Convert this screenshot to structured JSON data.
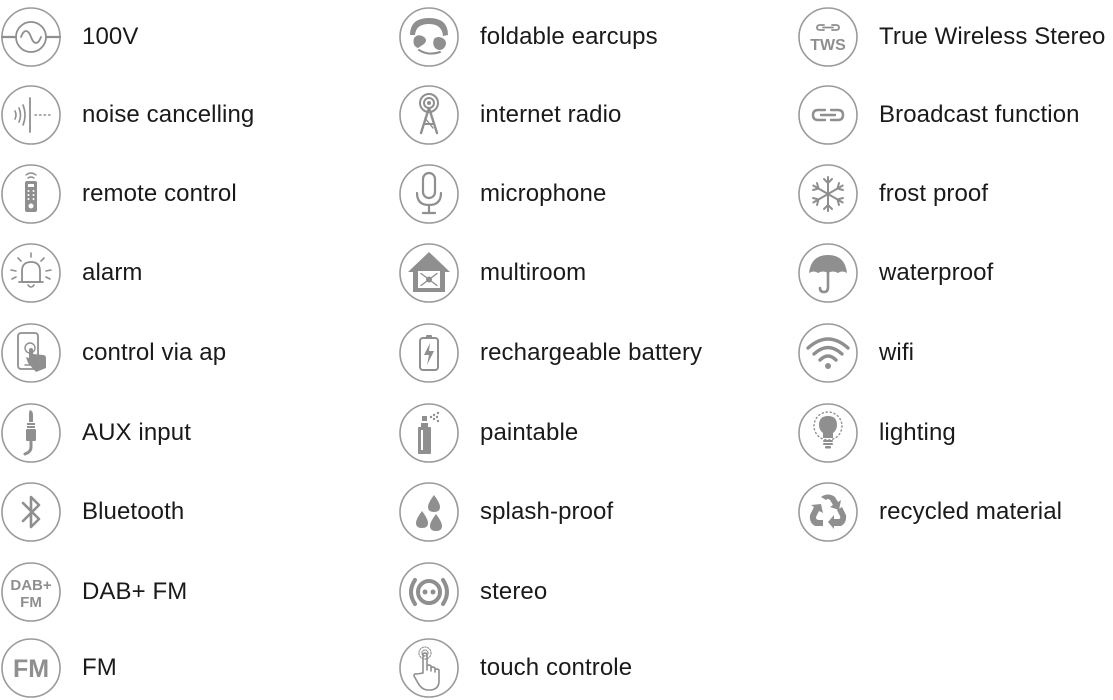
{
  "columns": [
    {
      "items": [
        {
          "label": "100V",
          "icon": "ac-voltage-icon"
        },
        {
          "label": "noise cancelling",
          "icon": "noise-cancelling-icon"
        },
        {
          "label": "remote control",
          "icon": "remote-control-icon"
        },
        {
          "label": "alarm",
          "icon": "alarm-icon"
        },
        {
          "label": "control via ap",
          "icon": "phone-touch-icon"
        },
        {
          "label": "AUX input",
          "icon": "aux-jack-icon"
        },
        {
          "label": "Bluetooth",
          "icon": "bluetooth-icon"
        },
        {
          "label": "DAB+ FM",
          "icon": "dab-fm-icon"
        },
        {
          "label": "FM",
          "icon": "fm-icon"
        }
      ]
    },
    {
      "items": [
        {
          "label": "foldable earcups",
          "icon": "headphones-icon"
        },
        {
          "label": "internet radio",
          "icon": "radio-tower-icon"
        },
        {
          "label": "microphone",
          "icon": "microphone-icon"
        },
        {
          "label": "multiroom",
          "icon": "multiroom-house-icon"
        },
        {
          "label": "rechargeable battery",
          "icon": "battery-icon"
        },
        {
          "label": "paintable",
          "icon": "spray-can-icon"
        },
        {
          "label": "splash-proof",
          "icon": "water-drops-icon"
        },
        {
          "label": "stereo",
          "icon": "stereo-icon"
        },
        {
          "label": "touch controle",
          "icon": "touch-hand-icon"
        }
      ]
    },
    {
      "items": [
        {
          "label": "True Wireless Stereo",
          "icon": "tws-icon",
          "icon_text": "TWS"
        },
        {
          "label": "Broadcast function",
          "icon": "link-icon"
        },
        {
          "label": "frost proof",
          "icon": "snowflake-icon"
        },
        {
          "label": "waterproof",
          "icon": "umbrella-icon"
        },
        {
          "label": "wifi",
          "icon": "wifi-icon"
        },
        {
          "label": "lighting",
          "icon": "light-bulb-icon"
        },
        {
          "label": "recycled material",
          "icon": "recycle-icon"
        }
      ]
    }
  ],
  "icon_texts": {
    "dab": "DAB+",
    "fm_small": "FM",
    "fm": "FM",
    "tws": "TWS"
  },
  "colors": {
    "icon_gray": "#8f8f8f",
    "ring_gray": "#9a9a9a",
    "text": "#1a1a1a",
    "background": "#ffffff"
  }
}
